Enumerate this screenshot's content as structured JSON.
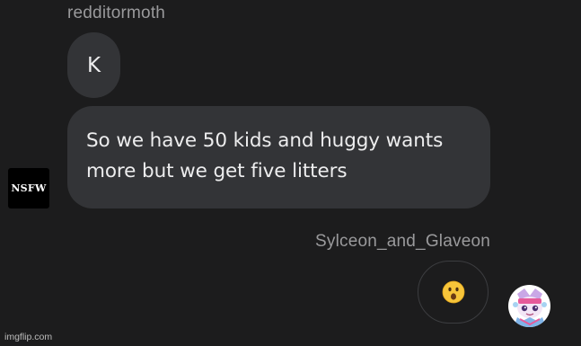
{
  "thread": {
    "incoming": {
      "sender": "redditormoth",
      "avatar_text": "NSFW",
      "messages": [
        "K",
        "So we have 50 kids and huggy wants more but we get five litters"
      ]
    },
    "outgoing": {
      "sender": "Sylceon_and_Glaveon",
      "reaction_icon": "surprised-face-emoji",
      "avatar_icon": "character-avatar"
    }
  },
  "watermark": "imgflip.com",
  "colors": {
    "background": "#1c1c1d",
    "bubble": "#333437",
    "name_text": "#9a9a9c",
    "bubble_text": "#ededee"
  }
}
